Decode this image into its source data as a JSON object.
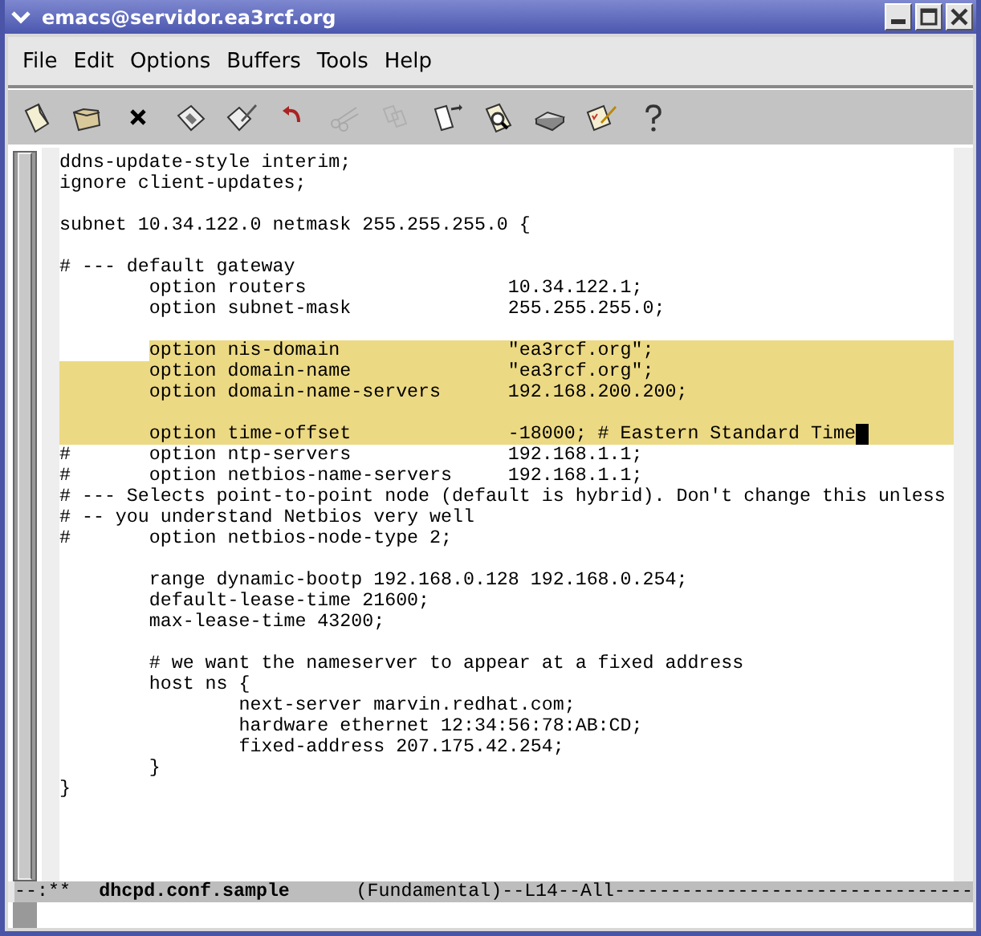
{
  "window": {
    "title": "emacs@servidor.ea3rcf.org"
  },
  "menu": [
    {
      "label": "File"
    },
    {
      "label": "Edit"
    },
    {
      "label": "Options"
    },
    {
      "label": "Buffers"
    },
    {
      "label": "Tools"
    },
    {
      "label": "Help"
    }
  ],
  "toolbar": [
    {
      "kind": "new",
      "disabled": false
    },
    {
      "kind": "open",
      "disabled": false
    },
    {
      "kind": "kill",
      "disabled": false
    },
    {
      "kind": "save",
      "disabled": false
    },
    {
      "kind": "saveas",
      "disabled": false
    },
    {
      "kind": "undo",
      "disabled": false
    },
    {
      "kind": "cut",
      "disabled": true
    },
    {
      "kind": "copy",
      "disabled": true
    },
    {
      "kind": "paste",
      "disabled": false
    },
    {
      "kind": "search",
      "disabled": false
    },
    {
      "kind": "print",
      "disabled": false
    },
    {
      "kind": "customize",
      "disabled": false
    },
    {
      "kind": "help",
      "disabled": false
    }
  ],
  "lines": [
    {
      "text": "ddns-update-style interim;",
      "highlighted": false
    },
    {
      "text": "ignore client-updates;",
      "highlighted": false
    },
    {
      "highlighted": false
    },
    {
      "text": "subnet 10.34.122.0 netmask 255.255.255.0 {",
      "highlighted": false
    },
    {
      "highlighted": false
    },
    {
      "text": "# --- default gateway",
      "highlighted": false
    },
    {
      "text": "        option routers                  10.34.122.1;",
      "highlighted": false
    },
    {
      "text": "        option subnet-mask              255.255.255.0;",
      "highlighted": false
    },
    {
      "highlighted": false
    },
    {
      "text": "        option nis-domain               \"ea3rcf.org\";",
      "highlighted": true
    },
    {
      "text": "        option domain-name              \"ea3rcf.org\";",
      "highlighted": true
    },
    {
      "text": "        option domain-name-servers      192.168.200.200;",
      "highlighted": true
    },
    {
      "highlighted": true
    },
    {
      "text": "        option time-offset              -18000; # Eastern Standard Time",
      "highlighted": true,
      "cursor": true
    },
    {
      "text": "#       option ntp-servers              192.168.1.1;",
      "highlighted": false
    },
    {
      "text": "#       option netbios-name-servers     192.168.1.1;",
      "highlighted": false
    },
    {
      "text": "# --- Selects point-to-point node (default is hybrid). Don't change this unless",
      "highlighted": false
    },
    {
      "text": "# -- you understand Netbios very well",
      "highlighted": false
    },
    {
      "text": "#       option netbios-node-type 2;",
      "highlighted": false
    },
    {
      "highlighted": false
    },
    {
      "text": "        range dynamic-bootp 192.168.0.128 192.168.0.254;",
      "highlighted": false
    },
    {
      "text": "        default-lease-time 21600;",
      "highlighted": false
    },
    {
      "text": "        max-lease-time 43200;",
      "highlighted": false
    },
    {
      "highlighted": false
    },
    {
      "text": "        # we want the nameserver to appear at a fixed address",
      "highlighted": false
    },
    {
      "text": "        host ns {",
      "highlighted": false
    },
    {
      "text": "                next-server marvin.redhat.com;",
      "highlighted": false
    },
    {
      "text": "                hardware ethernet 12:34:56:78:AB:CD;",
      "highlighted": false
    },
    {
      "text": "                fixed-address 207.175.42.254;",
      "highlighted": false
    },
    {
      "text": "        }",
      "highlighted": false
    },
    {
      "text": "}",
      "highlighted": false
    }
  ],
  "mode_line": {
    "status": "--:**",
    "buffer": "dhcpd.conf.sample",
    "mode": "(Fundamental)--L14--All--------------------------------"
  }
}
